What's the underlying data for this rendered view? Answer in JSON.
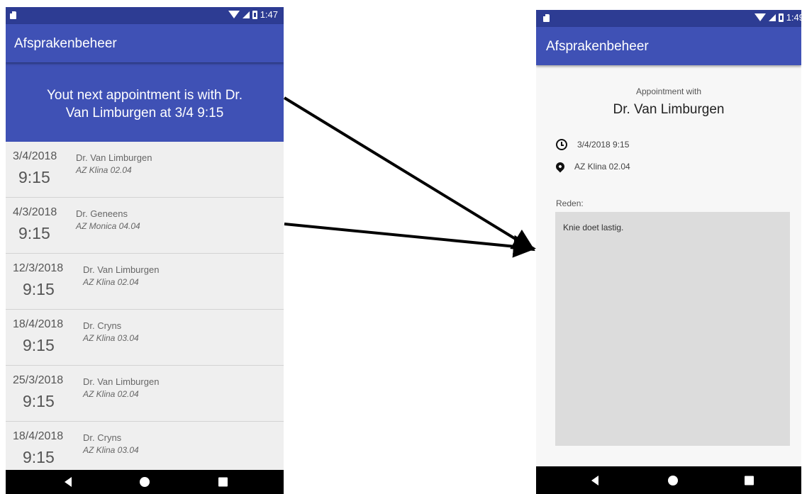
{
  "left_screen": {
    "status_time": "1:47",
    "app_title": "Afsprakenbeheer",
    "banner_line1": "Yout next appointment is with Dr.",
    "banner_line2": "Van Limburgen at 3/4 9:15",
    "appointments": [
      {
        "date": "3/4/2018",
        "time": "9:15",
        "doctor": "Dr. Van Limburgen",
        "location": "AZ Klina 02.04"
      },
      {
        "date": "4/3/2018",
        "time": "9:15",
        "doctor": "Dr. Geneens",
        "location": "AZ Monica 04.04"
      },
      {
        "date": "12/3/2018",
        "time": "9:15",
        "doctor": "Dr. Van Limburgen",
        "location": "AZ Klina 02.04"
      },
      {
        "date": "18/4/2018",
        "time": "9:15",
        "doctor": "Dr. Cryns",
        "location": "AZ Klina 03.04"
      },
      {
        "date": "25/3/2018",
        "time": "9:15",
        "doctor": "Dr. Van Limburgen",
        "location": "AZ Klina 02.04"
      },
      {
        "date": "18/4/2018",
        "time": "9:15",
        "doctor": "Dr. Cryns",
        "location": "AZ Klina 03.04"
      }
    ]
  },
  "right_screen": {
    "status_time": "1:49",
    "app_title": "Afsprakenbeheer",
    "appointment_label": "Appointment with",
    "doctor": "Dr. Van Limburgen",
    "datetime": "3/4/2018 9:15",
    "location": "AZ Klina 02.04",
    "reason_label": "Reden:",
    "reason_text": "Knie doet lastig."
  },
  "colors": {
    "primary": "#3f51b5",
    "primary_dark": "#2d3c93",
    "list_background": "#efefef",
    "reason_box": "#dcdcdc"
  },
  "icons": [
    "sd-card-icon",
    "wifi-icon",
    "signal-icon",
    "battery-icon",
    "back-icon",
    "home-icon",
    "recents-icon",
    "clock-icon",
    "location-pin-icon"
  ]
}
